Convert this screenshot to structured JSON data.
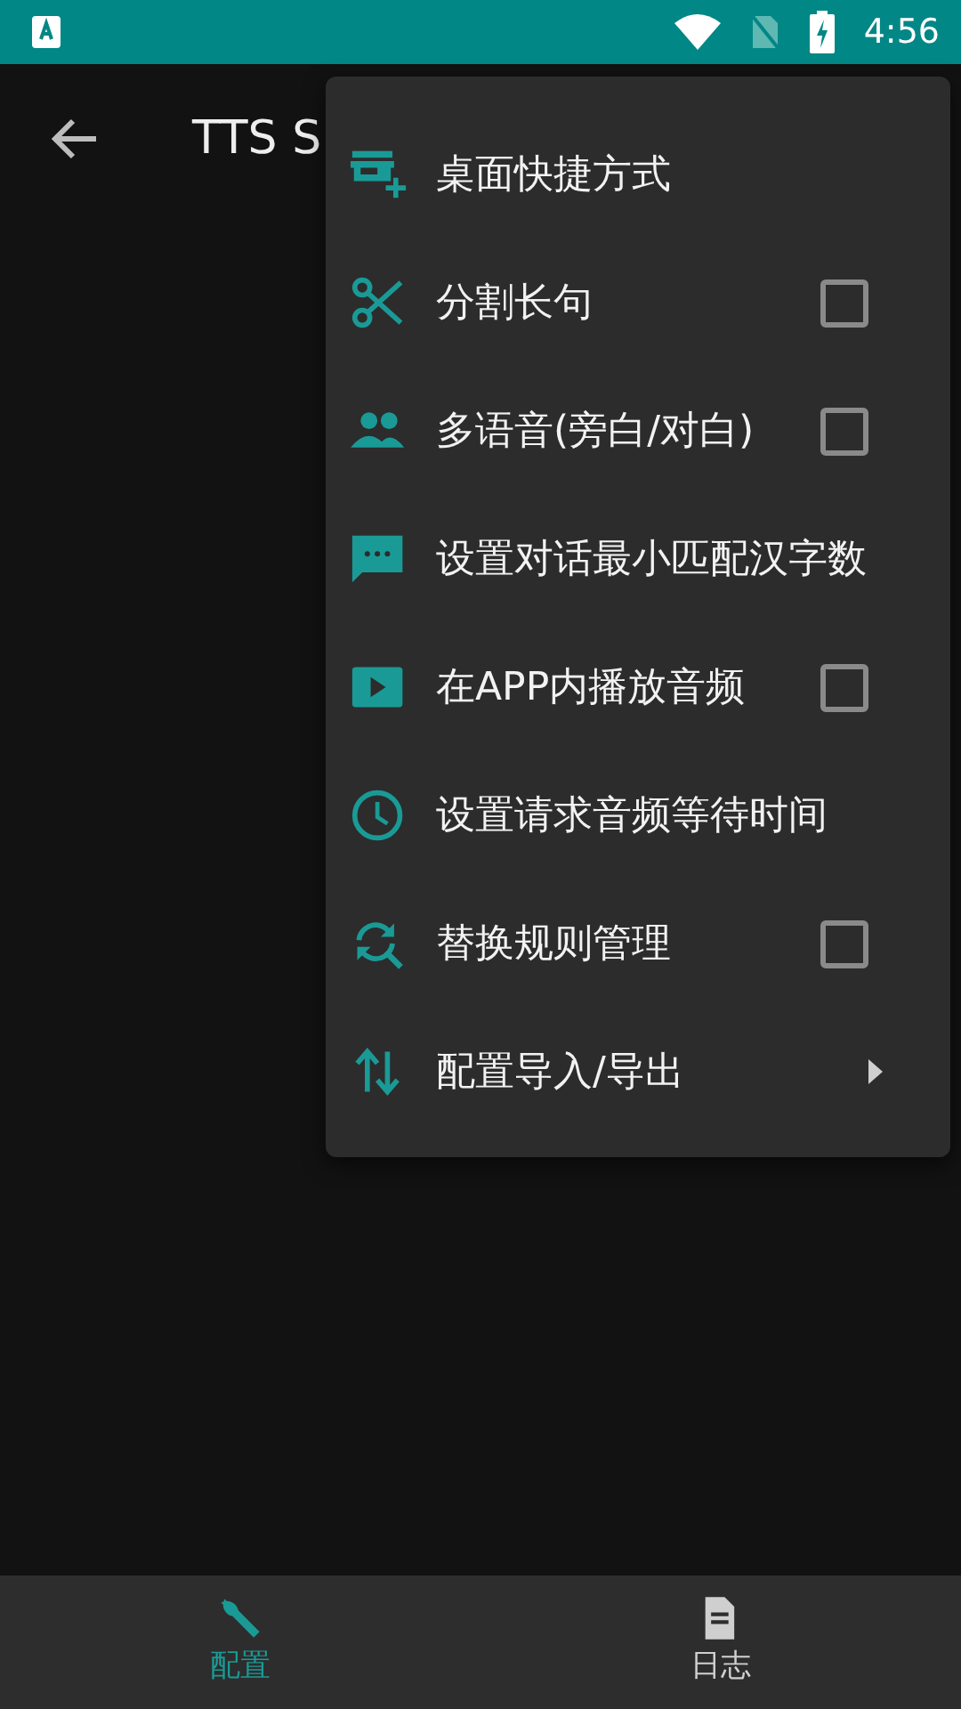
{
  "status_bar": {
    "time": "4:56"
  },
  "toolbar": {
    "title": "TTS S"
  },
  "menu": {
    "items": [
      {
        "label": "桌面快捷方式",
        "kind": "action"
      },
      {
        "label": "分割长句",
        "kind": "checkbox",
        "checked": false
      },
      {
        "label": "多语音(旁白/对白)",
        "kind": "checkbox",
        "checked": false
      },
      {
        "label": "设置对话最小匹配汉字数",
        "kind": "action"
      },
      {
        "label": "在APP内播放音频",
        "kind": "checkbox",
        "checked": false
      },
      {
        "label": "设置请求音频等待时间",
        "kind": "action"
      },
      {
        "label": "替换规则管理",
        "kind": "checkbox",
        "checked": false
      },
      {
        "label": "配置导入/导出",
        "kind": "submenu"
      }
    ]
  },
  "bottom_nav": [
    {
      "label": "配置",
      "selected": true
    },
    {
      "label": "日志",
      "selected": false
    }
  ]
}
